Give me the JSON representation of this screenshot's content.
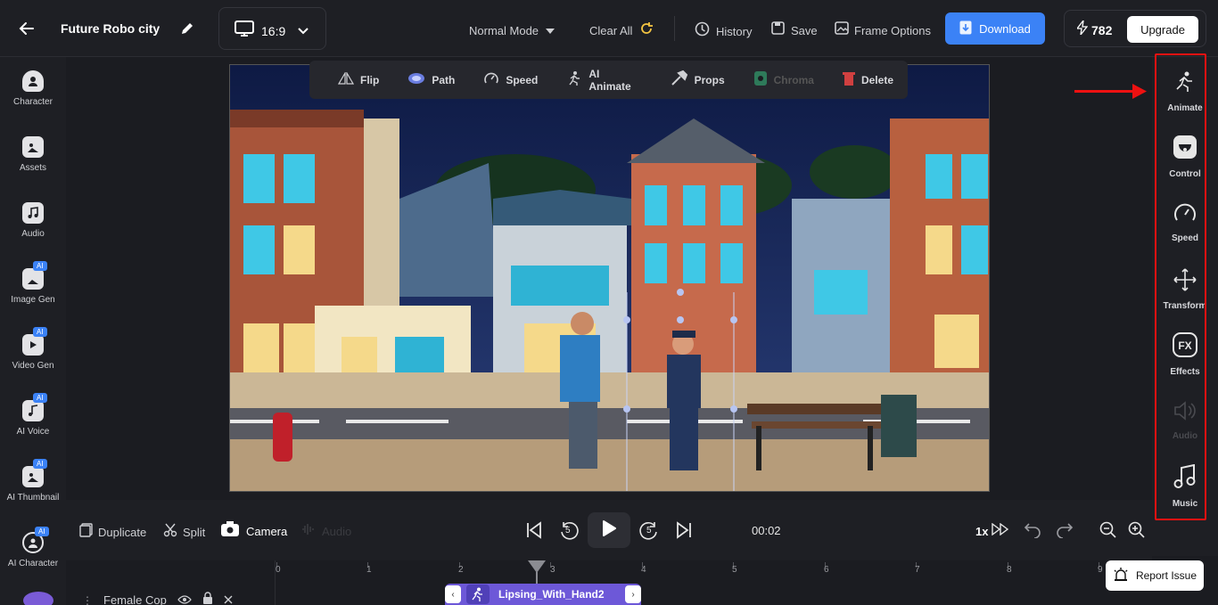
{
  "header": {
    "project_title": "Future Robo city",
    "aspect_ratio": "16:9",
    "mode": "Normal Mode",
    "clear_all": "Clear All",
    "history": "History",
    "save": "Save",
    "frame_options": "Frame Options",
    "download": "Download",
    "credits": "782",
    "upgrade": "Upgrade"
  },
  "left_sidebar": {
    "items": [
      {
        "label": "Character",
        "icon": "character-icon",
        "ai": false
      },
      {
        "label": "Assets",
        "icon": "assets-icon",
        "ai": false
      },
      {
        "label": "Audio",
        "icon": "audio-icon",
        "ai": false
      },
      {
        "label": "Image Gen",
        "icon": "image-gen-icon",
        "ai": true
      },
      {
        "label": "Video Gen",
        "icon": "video-gen-icon",
        "ai": true
      },
      {
        "label": "AI Voice",
        "icon": "ai-voice-icon",
        "ai": true
      },
      {
        "label": "AI Thumbnail",
        "icon": "ai-thumbnail-icon",
        "ai": true
      },
      {
        "label": "AI Character",
        "icon": "ai-character-icon",
        "ai": true
      }
    ],
    "ai_badge": "AI"
  },
  "floating_toolbar": {
    "items": [
      {
        "label": "Flip",
        "enabled": true
      },
      {
        "label": "Path",
        "enabled": true
      },
      {
        "label": "Speed",
        "enabled": true
      },
      {
        "label": "AI Animate",
        "enabled": true
      },
      {
        "label": "Props",
        "enabled": true
      },
      {
        "label": "Chroma",
        "enabled": false
      },
      {
        "label": "Delete",
        "enabled": true
      }
    ]
  },
  "right_panel": {
    "items": [
      {
        "label": "Animate",
        "enabled": true
      },
      {
        "label": "Control",
        "enabled": true
      },
      {
        "label": "Speed",
        "enabled": true
      },
      {
        "label": "Transform",
        "enabled": true
      },
      {
        "label": "Effects",
        "enabled": true
      },
      {
        "label": "Audio",
        "enabled": false
      },
      {
        "label": "Music",
        "enabled": true
      }
    ]
  },
  "controls": {
    "duplicate": "Duplicate",
    "split": "Split",
    "camera": "Camera",
    "audio": "Audio",
    "skip_back": "5",
    "skip_forward": "5",
    "time": "00:02",
    "speed": "1x"
  },
  "timeline": {
    "ruler": [
      "0",
      "1",
      "2",
      "3",
      "4",
      "5",
      "6",
      "7",
      "8",
      "9"
    ],
    "track_name": "Female Cop",
    "clip_label": "Lipsing_With_Hand2"
  },
  "report_issue": "Report Issue",
  "colors": {
    "accent": "#3b82f6",
    "highlight_frame": "#e11111",
    "clip": "#6d58d8"
  }
}
